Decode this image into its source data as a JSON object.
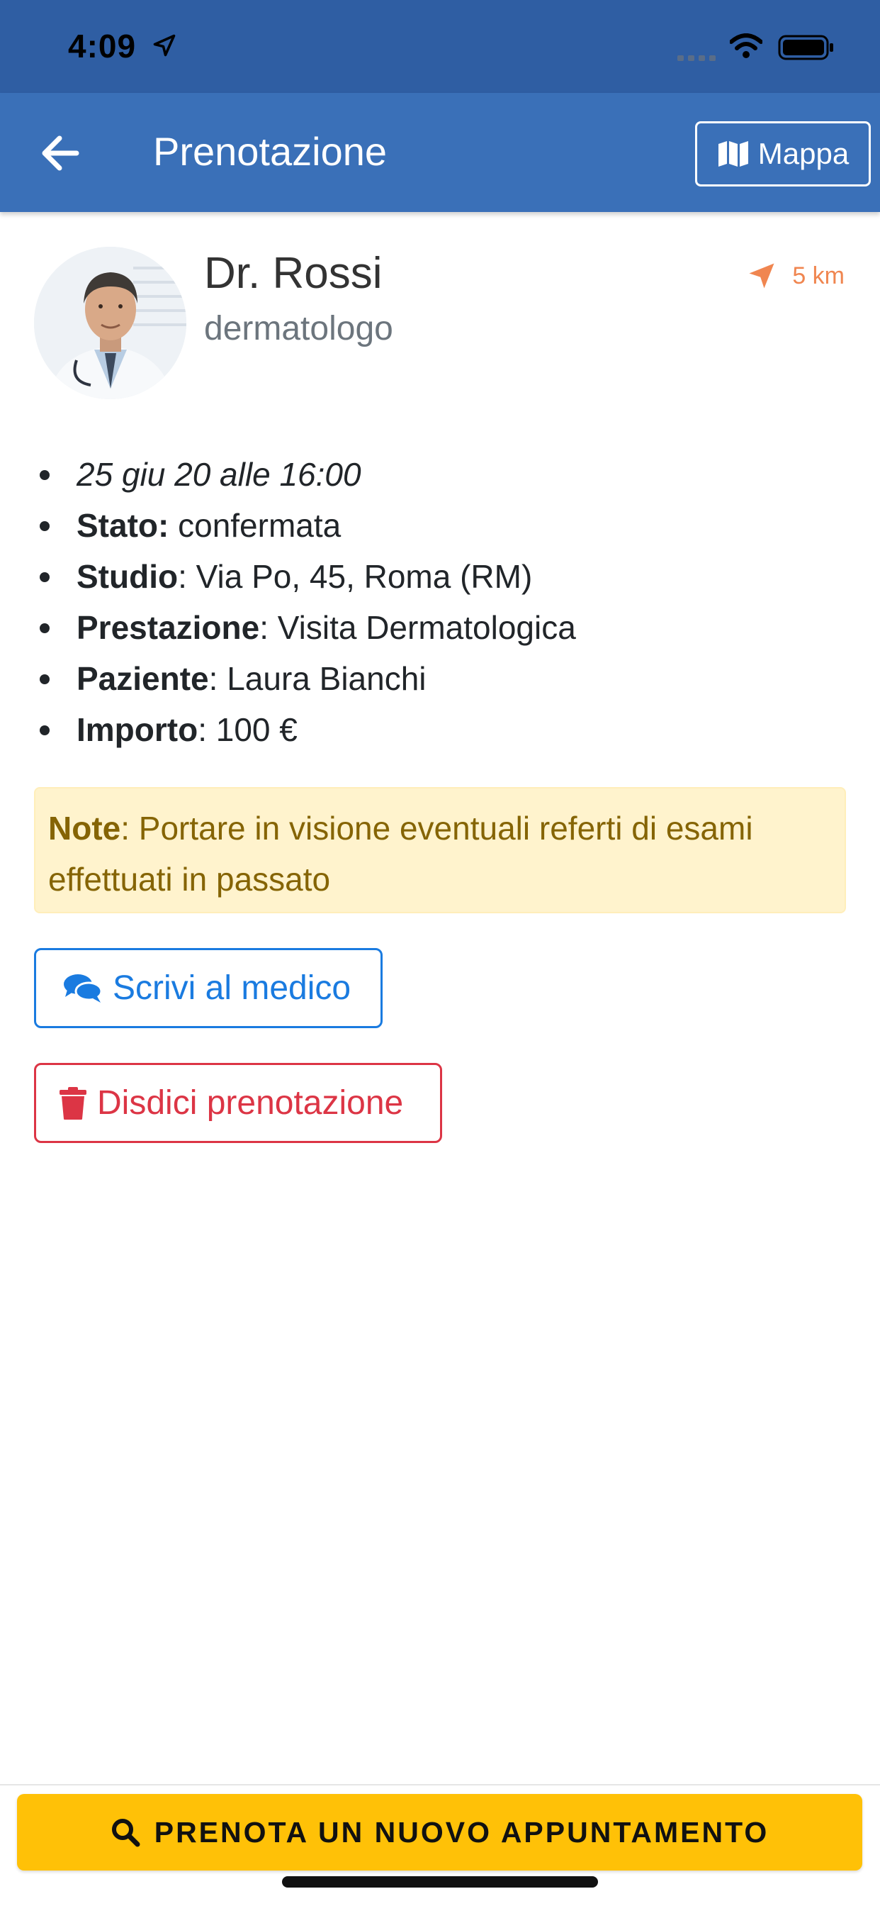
{
  "status_bar": {
    "time": "4:09"
  },
  "nav": {
    "title": "Prenotazione",
    "map_label": "Mappa"
  },
  "doctor": {
    "name": "Dr. Rossi",
    "specialty": "dermatologo",
    "distance": "5 km"
  },
  "details": {
    "datetime": "25 giu 20 alle 16:00",
    "status_label": "Stato:",
    "status_value": "confermata",
    "studio_label": "Studio",
    "studio_value": ": Via Po, 45, Roma (RM)",
    "service_label": "Prestazione",
    "service_value": ": Visita Dermatologica",
    "patient_label": "Paziente",
    "patient_value": ": Laura Bianchi",
    "amount_label": "Importo",
    "amount_value": ": 100 €"
  },
  "note": {
    "label": "Note",
    "text": ": Portare in visione eventuali referti di esami effettuati in passato"
  },
  "actions": {
    "write_label": "Scrivi al medico",
    "cancel_label": "Disdici prenotazione"
  },
  "footer": {
    "book_label": "PRENOTA UN NUOVO APPUNTAMENTO"
  },
  "colors": {
    "status_bar": "#2f5ea3",
    "nav_bar": "#3a70b8",
    "primary": "#1a7be0",
    "danger": "#dc3545",
    "warning": "#ffc107",
    "distance": "#f08650"
  }
}
